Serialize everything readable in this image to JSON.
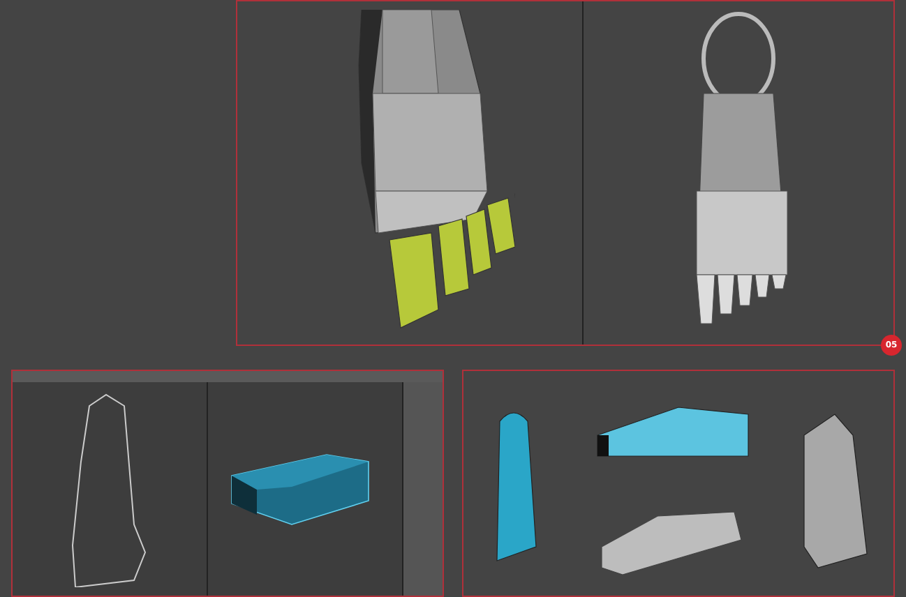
{
  "badge": {
    "label": "05"
  }
}
